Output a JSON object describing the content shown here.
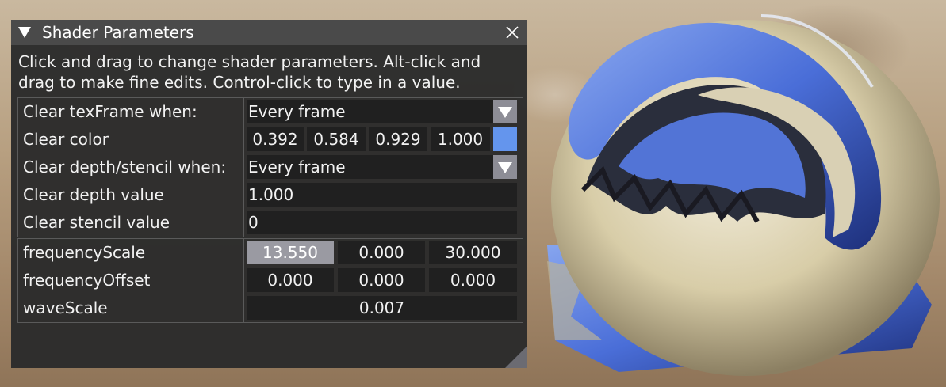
{
  "window": {
    "title": "Shader Parameters",
    "help_text": "Click and drag to change shader parameters. Alt-click and drag to make fine edits. Control-click to type in a value.",
    "icons": {
      "collapse": "triangle-down-icon",
      "close": "close-icon",
      "resize": "resize-grip-icon"
    }
  },
  "clear_settings": {
    "tex_frame_when": {
      "label": "Clear texFrame when:",
      "value": "Every frame"
    },
    "clear_color": {
      "label": "Clear color",
      "r": "0.392",
      "g": "0.584",
      "b": "0.929",
      "a": "1.000",
      "swatch_color": "#6495ED"
    },
    "depth_stencil_when": {
      "label": "Clear depth/stencil when:",
      "value": "Every frame"
    },
    "depth_value": {
      "label": "Clear depth value",
      "value": "1.000"
    },
    "stencil_value": {
      "label": "Clear stencil value",
      "value": "0"
    }
  },
  "shader_params": {
    "frequency_scale": {
      "label": "frequencyScale",
      "x": "13.550",
      "y": "0.000",
      "z": "30.000"
    },
    "frequency_offset": {
      "label": "frequencyOffset",
      "x": "0.000",
      "y": "0.000",
      "z": "0.000"
    },
    "wave_scale": {
      "label": "waveScale",
      "value": "0.007"
    }
  },
  "colors": {
    "panel_bg": "#2b2b2b",
    "title_bg": "#4a4a4a",
    "field_bg": "#202020",
    "active_field": "#9a9aa2",
    "dropdown_button": "#8d8d96"
  }
}
